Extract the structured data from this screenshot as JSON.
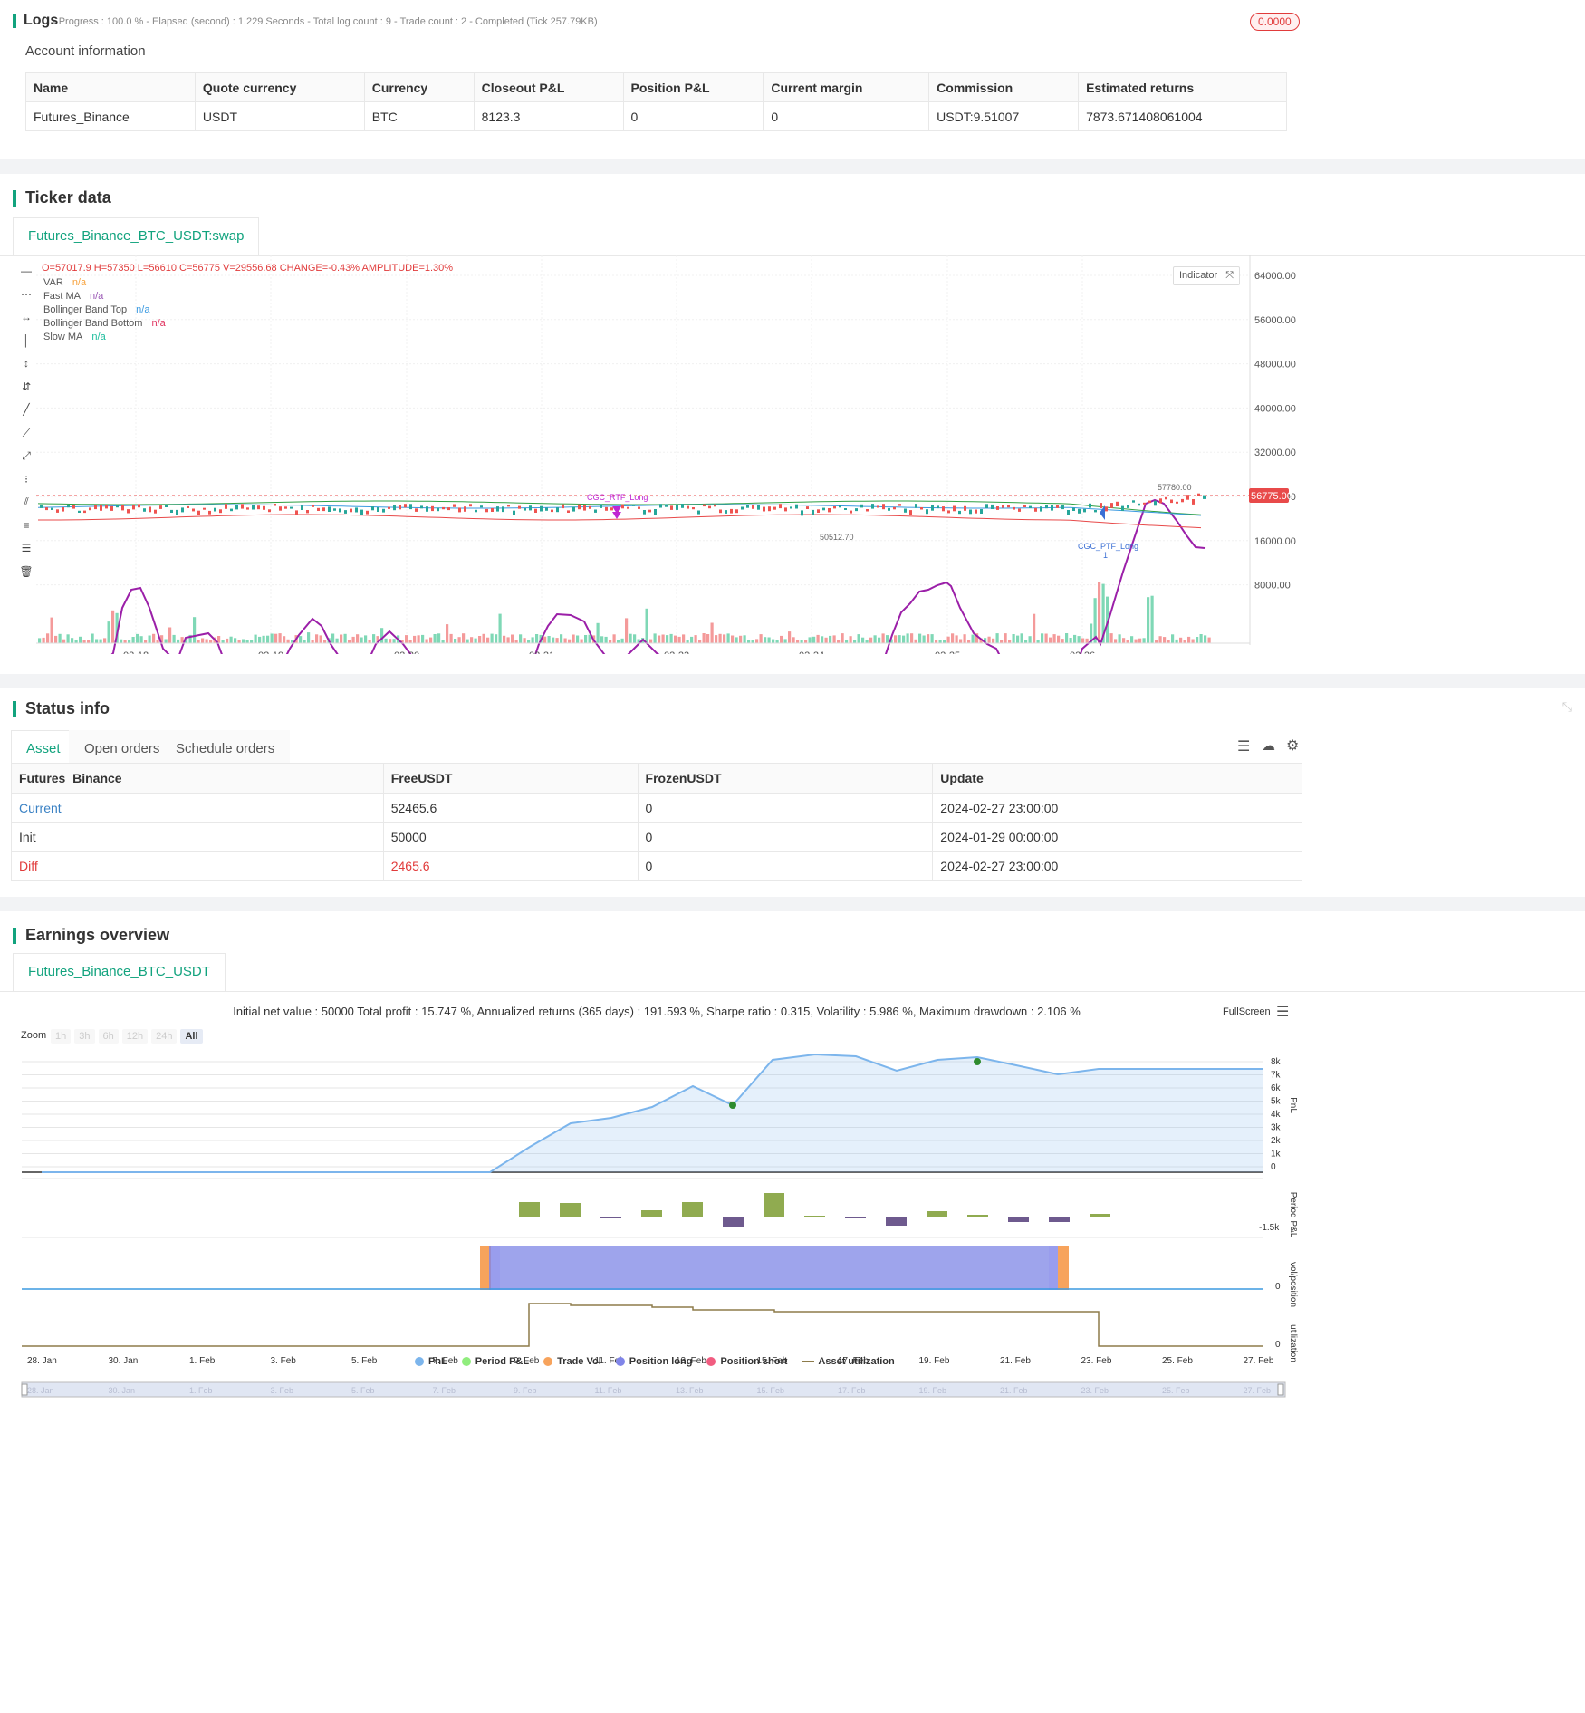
{
  "logs": {
    "title": "Logs",
    "meta": "- Progress : 100.0 % - Elapsed (second) : 1.229  Seconds - Total log count : 9 - Trade count : 2 - Completed (Tick 257.79KB)",
    "badge": "0.0000"
  },
  "account": {
    "title": "Account information",
    "headers": [
      "Name",
      "Quote currency",
      "Currency",
      "Closeout P&L",
      "Position P&L",
      "Current margin",
      "Commission",
      "Estimated returns"
    ],
    "row": [
      "Futures_Binance",
      "USDT",
      "BTC",
      "8123.3",
      "0",
      "0",
      "USDT:9.51007",
      "7873.671408061004"
    ]
  },
  "ticker": {
    "title": "Ticker data",
    "tab": "Futures_Binance_BTC_USDT:swap",
    "ohlc": "O=57017.9 H=57350 L=56610 C=56775 V=29556.68 CHANGE=-0.43% AMPLITUDE=1.30%",
    "legend": [
      {
        "name": "VAR",
        "value": "n/a",
        "color": "#f7a13a"
      },
      {
        "name": "Fast MA",
        "value": "n/a",
        "color": "#9b59b6"
      },
      {
        "name": "Bollinger Band Top",
        "value": "n/a",
        "color": "#3b9ae1"
      },
      {
        "name": "Bollinger Band Bottom",
        "value": "n/a",
        "color": "#e0325e"
      },
      {
        "name": "Slow MA",
        "value": "n/a",
        "color": "#1abc9c"
      }
    ],
    "indicator_btn": "Indicator",
    "price_tag": "56775.00",
    "y_labels": [
      "64000.00",
      "56000.00",
      "48000.00",
      "40000.00",
      "32000.00",
      "24000.00",
      "16000.00",
      "8000.00"
    ],
    "x_labels": [
      "02-18",
      "02-19",
      "02-20",
      "02-21",
      "02-23",
      "02-24",
      "02-25",
      "02-26"
    ],
    "annotations": {
      "high": "57780.00",
      "low": "50512.70",
      "short": "CGC_RTF_Long",
      "long": "CGC_PTF_Long",
      "count": "1"
    }
  },
  "status": {
    "title": "Status info",
    "tabs": [
      "Asset",
      "Open orders",
      "Schedule orders"
    ],
    "headers": [
      "Futures_Binance",
      "FreeUSDT",
      "FrozenUSDT",
      "Update"
    ],
    "rows": [
      [
        "Current",
        "52465.6",
        "0",
        "2024-02-27 23:00:00"
      ],
      [
        "Init",
        "50000",
        "0",
        "2024-01-29 00:00:00"
      ],
      [
        "Diff",
        "2465.6",
        "0",
        "2024-02-27 23:00:00"
      ]
    ]
  },
  "earnings": {
    "title": "Earnings overview",
    "tab": "Futures_Binance_BTC_USDT",
    "summary": "Initial net value : 50000 Total profit : 15.747 %, Annualized returns (365 days) : 191.593 %, Sharpe ratio : 0.315, Volatility : 5.986 %, Maximum drawdown : 2.106 %",
    "fullscreen": "FullScreen",
    "zoom_label": "Zoom",
    "zoom": [
      "1h",
      "3h",
      "6h",
      "12h",
      "24h",
      "All"
    ],
    "pnl_labels": [
      "8k",
      "7k",
      "6k",
      "5k",
      "4k",
      "3k",
      "2k",
      "1k",
      "0"
    ],
    "period_label": "-1.5k",
    "axis_titles": [
      "PnL",
      "Period P&L",
      "vol/position",
      "utilization"
    ],
    "zero": "0",
    "x_labels": [
      "28. Jan",
      "30. Jan",
      "1. Feb",
      "3. Feb",
      "5. Feb",
      "7. Feb",
      "9. Feb",
      "11. Feb",
      "13. Feb",
      "15. Feb",
      "17. Feb",
      "19. Feb",
      "21. Feb",
      "23. Feb",
      "25. Feb",
      "27. Feb"
    ],
    "legend": [
      {
        "name": "PnL",
        "color": "#7cb5ec"
      },
      {
        "name": "Period P&L",
        "color": "#90ed7d"
      },
      {
        "name": "Trade Vol",
        "color": "#f7a35c"
      },
      {
        "name": "Position long",
        "color": "#8085e9"
      },
      {
        "name": "Position short",
        "color": "#f15c80"
      },
      {
        "name": "Asset utilization",
        "color": "#8d7b4a"
      }
    ]
  },
  "chart_data": {
    "type": "line",
    "title": "",
    "x": [
      "28. Jan",
      "30. Jan",
      "1. Feb",
      "3. Feb",
      "5. Feb",
      "7. Feb",
      "9. Feb",
      "11. Feb",
      "13. Feb",
      "15. Feb",
      "17. Feb",
      "19. Feb",
      "21. Feb",
      "23. Feb",
      "25. Feb",
      "27. Feb"
    ],
    "series": [
      {
        "name": "PnL",
        "values": [
          0,
          0,
          0,
          0,
          0,
          0,
          2500,
          3900,
          5300,
          7600,
          7800,
          7900,
          7300,
          7500,
          7500,
          7500
        ]
      }
    ],
    "ylim": [
      0,
      8500
    ]
  }
}
